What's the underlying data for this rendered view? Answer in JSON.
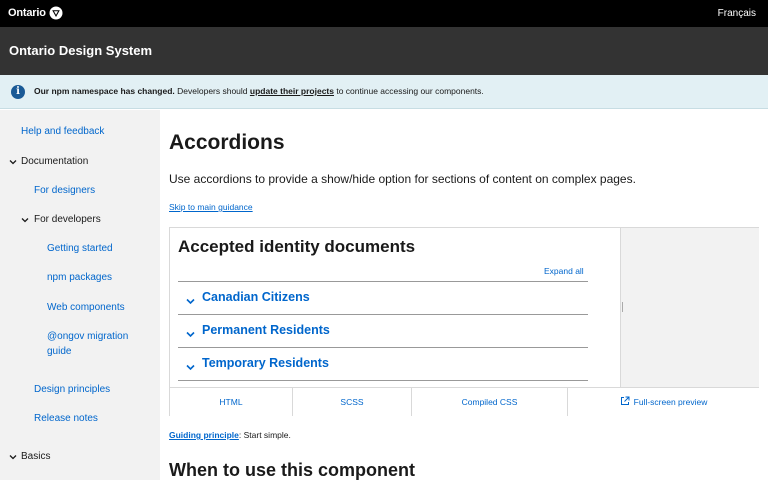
{
  "topbar": {
    "logo_text": "Ontario",
    "language_toggle": "Français"
  },
  "header": {
    "site_title": "Ontario Design System"
  },
  "alert": {
    "bold_text": "Our npm namespace has changed.",
    "text_before_link": " Developers should ",
    "link_text": "update their projects",
    "text_after_link": " to continue accessing our components."
  },
  "sidebar": {
    "help": "Help and feedback",
    "documentation": "Documentation",
    "for_designers": "For designers",
    "for_developers": "For developers",
    "getting_started": "Getting started",
    "npm_packages": "npm packages",
    "web_components": "Web components",
    "migration_line1": "@ongov migration",
    "migration_line2": "guide",
    "design_principles": "Design principles",
    "release_notes": "Release notes",
    "basics": "Basics"
  },
  "main": {
    "title": "Accordions",
    "lead": "Use accordions to provide a show/hide option for sections of content on complex pages.",
    "skip_link": "Skip to main guidance",
    "preview": {
      "heading": "Accepted identity documents",
      "expand_all": "Expand all",
      "items": [
        "Canadian Citizens",
        "Permanent Residents",
        "Temporary Residents"
      ]
    },
    "tabs": [
      "HTML",
      "SCSS",
      "Compiled CSS",
      "Full-screen preview"
    ],
    "guiding_label": "Guiding principle",
    "guiding_text": ": Start simple.",
    "section_heading": "When to use this component"
  }
}
